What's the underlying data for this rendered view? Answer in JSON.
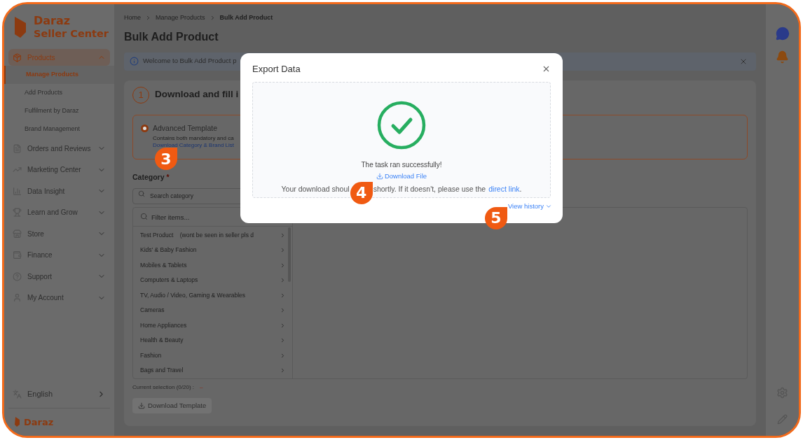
{
  "sidebar": {
    "logo_line1": "Daraz",
    "logo_line2": "Seller Center",
    "items": [
      {
        "label": "Products",
        "expanded": true,
        "selected": true,
        "children": [
          {
            "label": "Manage Products",
            "selected": true
          },
          {
            "label": "Add Products",
            "selected": false
          },
          {
            "label": "Fulfilment by Daraz",
            "selected": false
          },
          {
            "label": "Brand Management",
            "selected": false
          }
        ]
      },
      {
        "label": "Orders and Reviews",
        "expanded": false,
        "selected": false
      },
      {
        "label": "Marketing Center",
        "expanded": false,
        "selected": false
      },
      {
        "label": "Data Insight",
        "expanded": false,
        "selected": false
      },
      {
        "label": "Learn and Grow",
        "expanded": false,
        "selected": false
      },
      {
        "label": "Store",
        "expanded": false,
        "selected": false
      },
      {
        "label": "Finance",
        "expanded": false,
        "selected": false
      },
      {
        "label": "Support",
        "expanded": false,
        "selected": false
      },
      {
        "label": "My Account",
        "expanded": false,
        "selected": false
      }
    ],
    "language": "English",
    "footer_logo": "Daraz"
  },
  "breadcrumb": [
    "Home",
    "Manage Products",
    "Bulk Add Product"
  ],
  "page_title": "Bulk Add Product",
  "notice": "Welcome to Bulk Add Product p",
  "step": {
    "number": "1",
    "title": "Download and fill i"
  },
  "template_option": {
    "label": "Advanced Template",
    "selected": true,
    "description": "Contains both mandatory and ca",
    "link": "Download Category & Brand List"
  },
  "category": {
    "label": "Category",
    "required_mark": "*",
    "search_placeholder": "Search category",
    "filter_placeholder": "Filter items...",
    "items": [
      "Test Product    (wont be seen in seller pls d",
      "Kids' & Baby Fashion",
      "Mobiles & Tablets",
      "Computers & Laptops",
      "TV, Audio / Video, Gaming & Wearables",
      "Cameras",
      "Home Appliances",
      "Health & Beauty",
      "Fashion",
      "Bags and Travel"
    ],
    "selection_label": "Current selection (0/20) :",
    "selection_value": "–"
  },
  "download_button": {
    "label": "Download Template",
    "disabled": true
  },
  "modal": {
    "title": "Export Data",
    "status": "The task ran successfully!",
    "download_link": "Download File",
    "message_start": "Your download shoul",
    "message_end": "shortly. If it doesn't, please use the",
    "direct_link": "direct link",
    "message_suffix": ".",
    "history_link": "View history"
  },
  "markers": [
    "3",
    "4",
    "5"
  ]
}
